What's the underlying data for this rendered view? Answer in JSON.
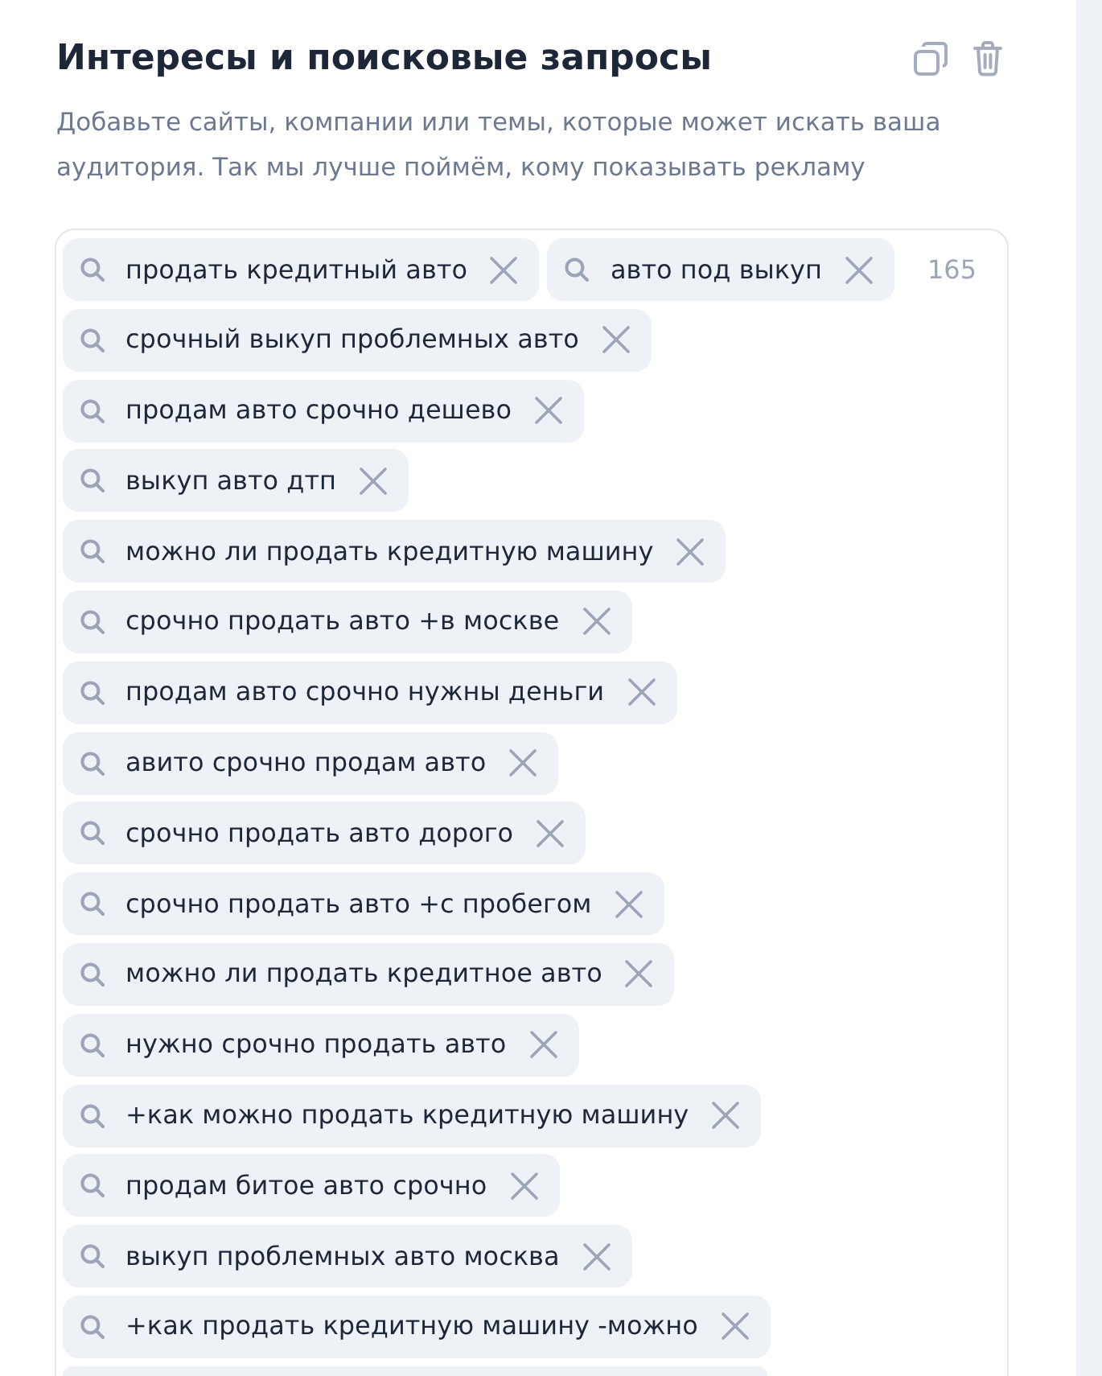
{
  "section": {
    "title": "Интересы и поисковые запросы",
    "description": "Добавьте сайты, компании или темы, которые может искать ваша аудитория. Так мы лучше поймём, кому показывать рекламу",
    "actions": [
      {
        "kind": "copy"
      },
      {
        "kind": "delete"
      }
    ]
  },
  "query_field": {
    "count": "165",
    "more_below": true,
    "tags": [
      {
        "text": "продать кредитный авто"
      },
      {
        "text": "авто под выкуп"
      },
      {
        "text": "срочный выкуп проблемных авто"
      },
      {
        "text": "продам авто срочно дешево"
      },
      {
        "text": "выкуп авто дтп"
      },
      {
        "text": "можно ли продать кредитную машину"
      },
      {
        "text": "срочно продать авто +в москве"
      },
      {
        "text": "продам авто срочно нужны деньги"
      },
      {
        "text": "авито срочно продам авто"
      },
      {
        "text": "срочно продать авто дорого"
      },
      {
        "text": "срочно продать авто +с пробегом"
      },
      {
        "text": "можно ли продать кредитное авто"
      },
      {
        "text": "нужно срочно продать авто"
      },
      {
        "text": "+как можно продать кредитную машину"
      },
      {
        "text": "продам битое авто срочно"
      },
      {
        "text": "выкуп проблемных авто москва"
      },
      {
        "text": "+как продать кредитную машину -можно"
      }
    ]
  }
}
